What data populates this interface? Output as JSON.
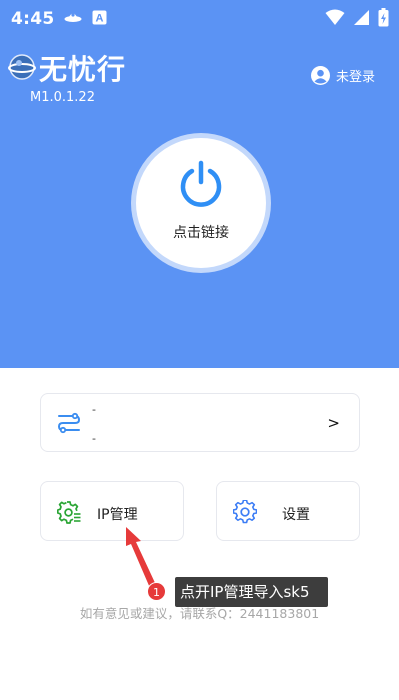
{
  "status_bar": {
    "time": "4:45",
    "icons": [
      "ufo-icon",
      "a-notification-icon",
      "wifi-icon",
      "signal-icon",
      "battery-icon"
    ]
  },
  "header": {
    "title": "无忧行",
    "version": "M1.0.1.22",
    "login_label": "未登录",
    "background_color": "#5b93f4"
  },
  "connect": {
    "label": "点击链接",
    "icon": "power-icon",
    "accent_color": "#2f8ff5"
  },
  "server": {
    "line1": "-",
    "line2": "-",
    "arrow": ">",
    "icon": "route-icon"
  },
  "actions": {
    "ip_management": {
      "label": "IP管理",
      "icon": "gear-list-icon",
      "icon_color": "#2aa534"
    },
    "settings": {
      "label": "设置",
      "icon": "gear-icon",
      "icon_color": "#3c7df5"
    }
  },
  "footer": {
    "contact": "如有意见或建议，请联系Q：2441183801"
  },
  "annotation": {
    "badge": "1",
    "tooltip": "点开IP管理导入sk5",
    "color": "#e63a3a"
  }
}
